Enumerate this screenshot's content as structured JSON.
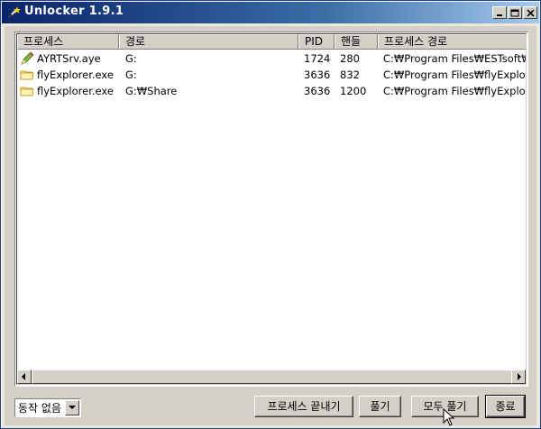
{
  "window": {
    "title": "Unlocker 1.9.1"
  },
  "list": {
    "columns": [
      "프로세스",
      "경로",
      "PID",
      "핸들",
      "프로세스 경로"
    ],
    "rows": [
      {
        "icon": "pencil-app-icon",
        "process": "AYRTSrv.aye",
        "path": "G:",
        "pid": "1724",
        "handle": "280",
        "process_path": "C:₩Program Files₩ESTsoft₩ALY"
      },
      {
        "icon": "folder-icon",
        "process": "flyExplorer.exe",
        "path": "G:",
        "pid": "3636",
        "handle": "832",
        "process_path": "C:₩Program Files₩flyExplorer₩"
      },
      {
        "icon": "folder-icon",
        "process": "flyExplorer.exe",
        "path": "G:₩Share",
        "pid": "3636",
        "handle": "1200",
        "process_path": "C:₩Program Files₩flyExplorer₩"
      }
    ]
  },
  "action_select": {
    "value": "동작 없음"
  },
  "buttons": {
    "kill_process": "프로세스 끝내기",
    "unlock": "풀기",
    "unlock_all": "모두 풀기",
    "quit": "종료"
  }
}
